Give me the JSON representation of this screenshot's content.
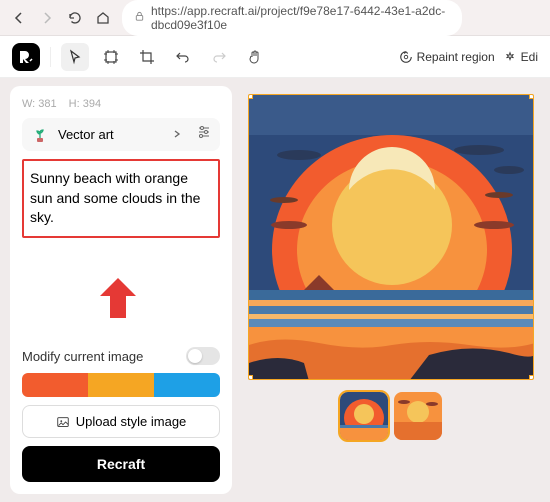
{
  "browser": {
    "url": "https://app.recraft.ai/project/f9e78e17-6442-43e1-a2dc-dbcd09e3f10e"
  },
  "toolbar": {
    "repaint_label": "Repaint region",
    "edit_label": "Edi"
  },
  "sidebar": {
    "width": "W: 381",
    "height": "H: 394",
    "style_label": "Vector art",
    "prompt": "Sunny beach with orange sun and some clouds in the sky.",
    "modify_label": "Modify current image",
    "palette": [
      "#f25c2e",
      "#f5a623",
      "#1ea0e6"
    ],
    "upload_label": "Upload style image",
    "recraft_label": "Recraft"
  }
}
